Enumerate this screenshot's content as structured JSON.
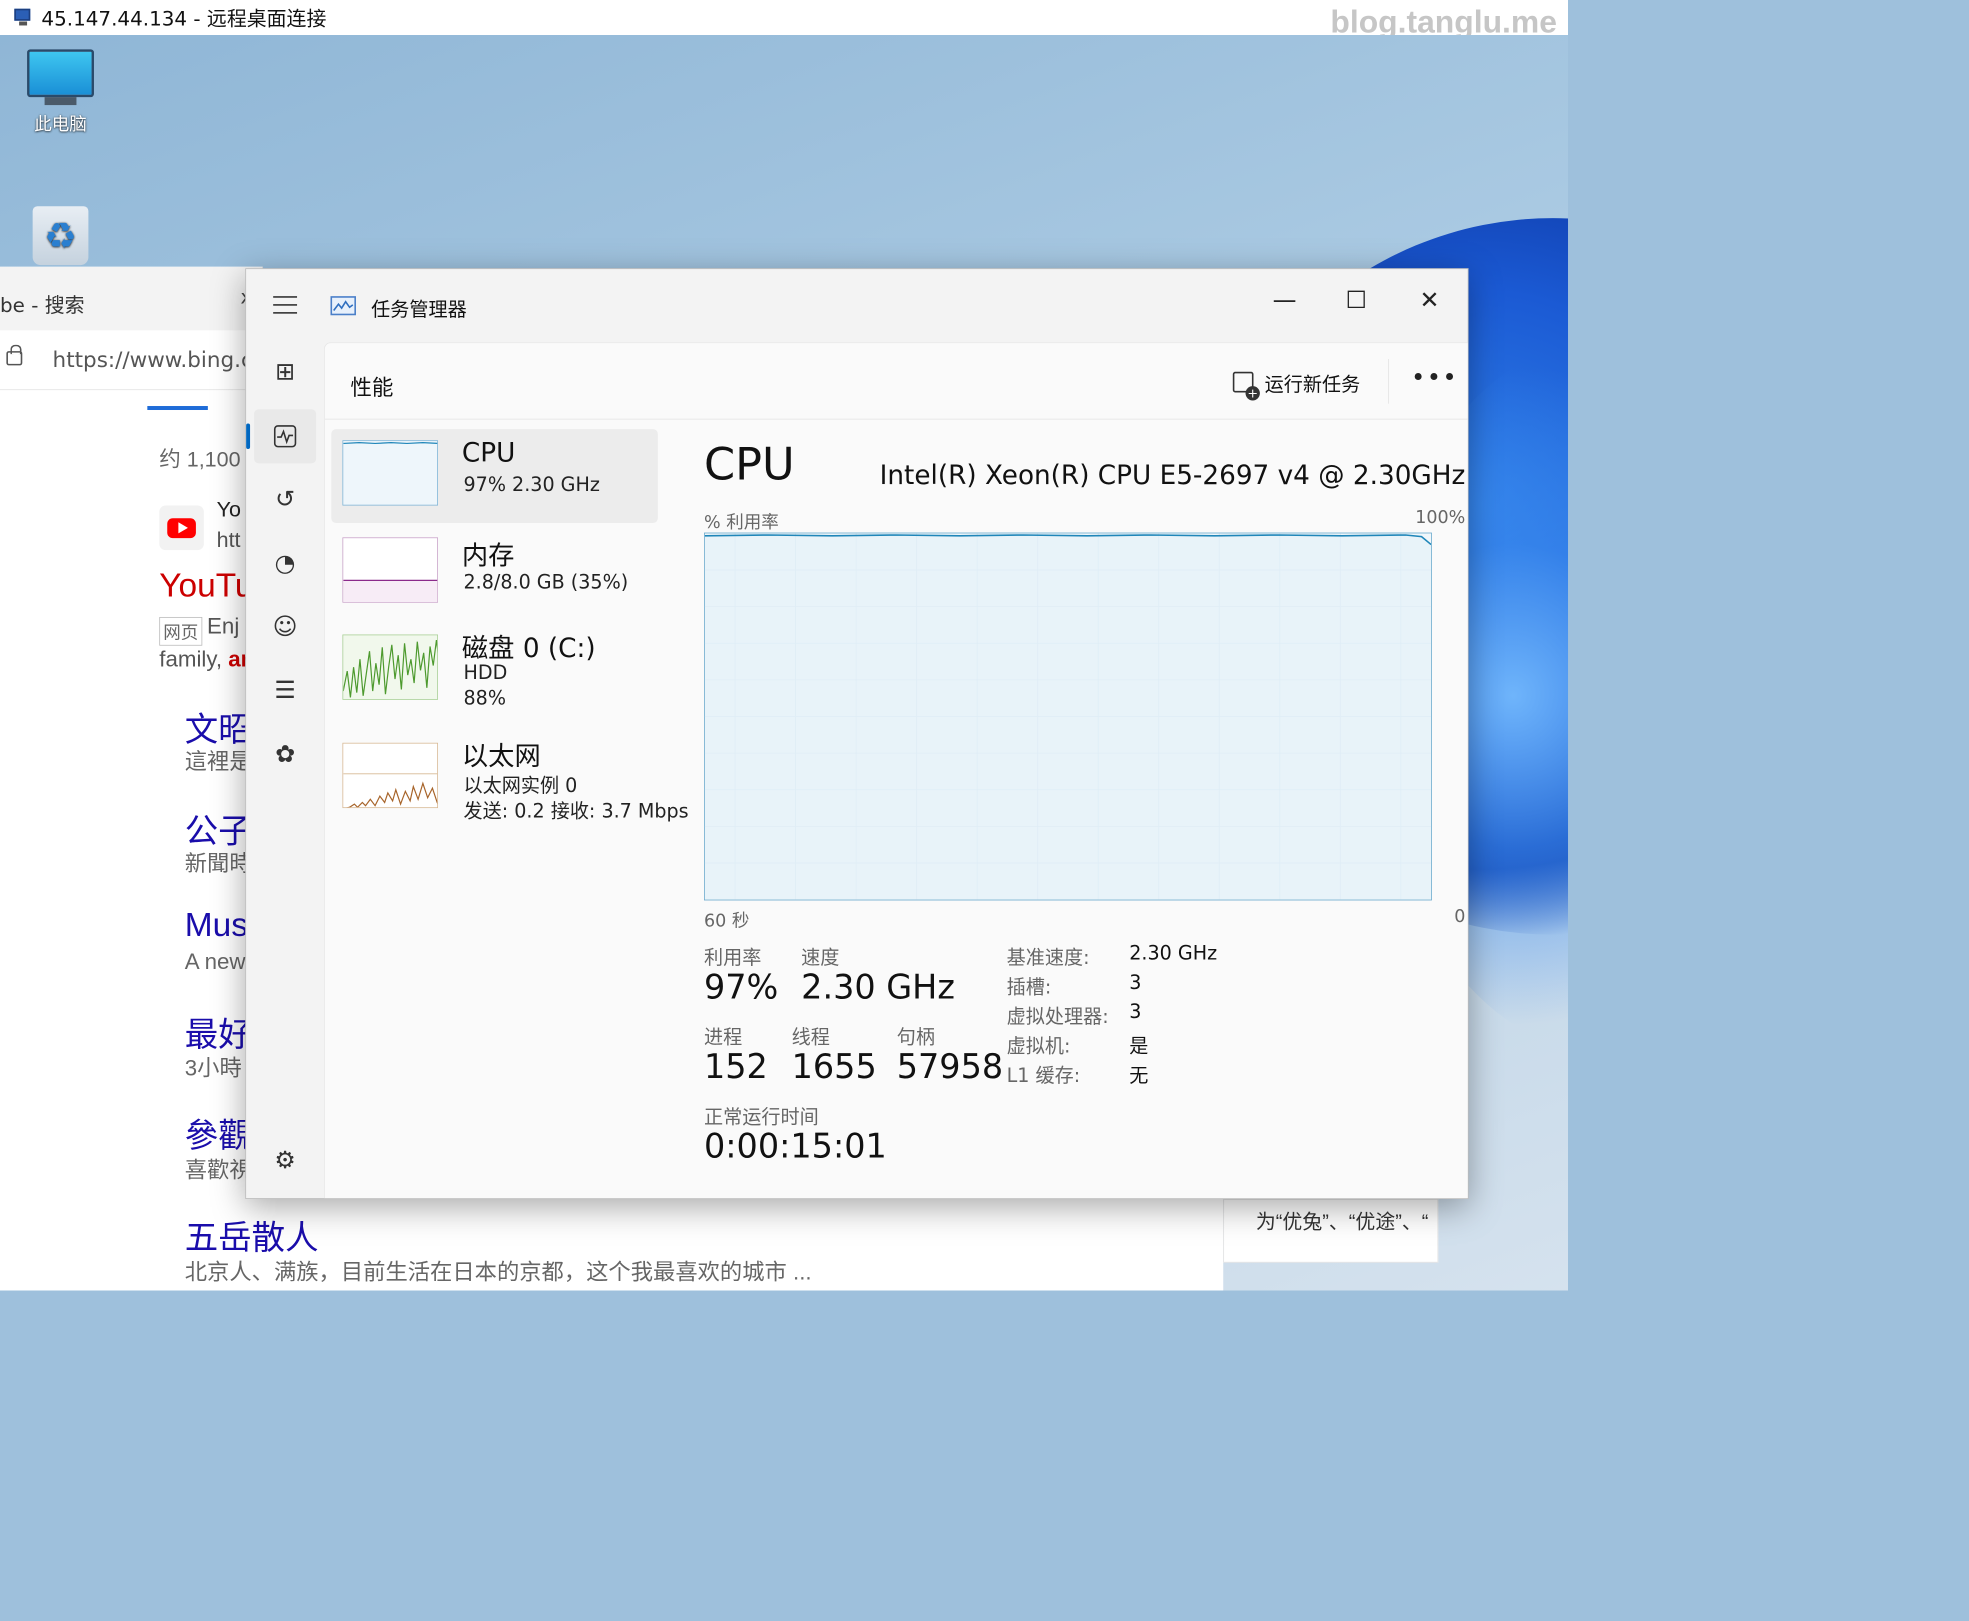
{
  "rdp": {
    "title": "45.147.44.134 - 远程桌面连接",
    "watermark": "blog.tanglu.me"
  },
  "desktop": {
    "icons": [
      {
        "label": "此电脑",
        "icon": "computer-icon"
      },
      {
        "label": "",
        "icon": "recycle-bin-icon"
      }
    ]
  },
  "browser": {
    "tab_title": "be - 搜索",
    "tab_close": "x",
    "url": "https://www.bing.cc",
    "result_count": "约 1,100",
    "yt_line1": "Yo",
    "yt_line2": "htt",
    "yt_title": "YouTu",
    "yt_badge": "网页",
    "yt_desc": "Enj",
    "yt_desc2_a": "family, ",
    "yt_desc2_b": "ar",
    "results": [
      {
        "title": "文昭",
        "desc": "這裡是"
      },
      {
        "title": "公子",
        "desc": "新聞時"
      },
      {
        "title": "Mus",
        "desc": "A new"
      },
      {
        "title": "最好",
        "desc": "3小時"
      },
      {
        "title": "參觀",
        "desc": "喜歡視"
      }
    ],
    "last_title": "五岳散人",
    "last_desc": "北京人、满族，目前生活在日本的京都，这个我最喜欢的城市 ...",
    "side_snippet": "为“优兔”、“优途”、“"
  },
  "taskmgr": {
    "title": "任务管理器",
    "minimize": "—",
    "maximize": "☐",
    "close": "✕",
    "page_title": "性能",
    "run_new_task": "运行新任务",
    "more": "•••",
    "nav_icons": [
      "processes-icon",
      "performance-icon",
      "app-history-icon",
      "startup-apps-icon",
      "users-icon",
      "details-icon",
      "services-icon",
      "settings-icon"
    ],
    "sidebar": [
      {
        "name": "CPU",
        "sub1": "97%  2.30 GHz",
        "sub2": "",
        "active": true
      },
      {
        "name": "内存",
        "sub1": "2.8/8.0 GB (35%)",
        "sub2": "",
        "active": false
      },
      {
        "name": "磁盘 0 (C:)",
        "sub1": "HDD",
        "sub2": "88%",
        "active": false
      },
      {
        "name": "以太网",
        "sub1": "以太网实例 0",
        "sub2": "发送: 0.2 接收: 3.7 Mbps",
        "active": false
      }
    ],
    "detail": {
      "heading": "CPU",
      "model": "Intel(R) Xeon(R) CPU E5-2697 v4 @ 2.30GHz",
      "graph_label": "% 利用率",
      "graph_max": "100%",
      "time_left": "60 秒",
      "time_right": "0",
      "util_label": "利用率",
      "util_value": "97%",
      "speed_label": "速度",
      "speed_value": "2.30 GHz",
      "proc_label": "进程",
      "proc_value": "152",
      "thread_label": "线程",
      "thread_value": "1655",
      "handle_label": "句柄",
      "handle_value": "57958",
      "uptime_label": "正常运行时间",
      "uptime_value": "0:00:15:01",
      "specs": [
        {
          "k": "基准速度:",
          "v": "2.30 GHz"
        },
        {
          "k": "插槽:",
          "v": "3"
        },
        {
          "k": "虚拟处理器:",
          "v": "3"
        },
        {
          "k": "虚拟机:",
          "v": "是"
        },
        {
          "k": "L1 缓存:",
          "v": "无"
        }
      ]
    },
    "colors": {
      "cpu": "#1f86b9",
      "memory": "#8b2a8b",
      "disk": "#4d9a2e",
      "ethernet": "#a7642a",
      "accent": "#0067c0"
    }
  }
}
